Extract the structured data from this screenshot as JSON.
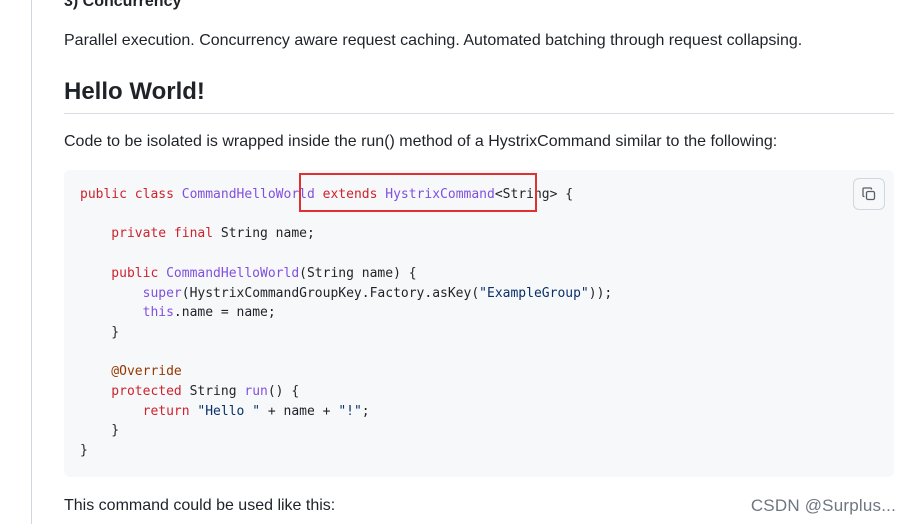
{
  "section": {
    "heading": "3) Concurrency",
    "paragraph": "Parallel execution. Concurrency aware request caching. Automated batching through request collapsing."
  },
  "hello": {
    "title": "Hello World!",
    "intro": "Code to be isolated is wrapped inside the run() method of a HystrixCommand similar to the following:",
    "outro": "This command could be used like this:"
  },
  "code": {
    "line1": {
      "kw1": "public class ",
      "cls": "CommandHelloWorld",
      "kw2": " extends ",
      "sup": "HystrixCommand",
      "rest": "<String> {"
    },
    "line3": {
      "kw": "    private final ",
      "rest": "String name;"
    },
    "line5": {
      "kw": "    public ",
      "fn": "CommandHelloWorld",
      "rest": "(String name) {"
    },
    "line6": {
      "kw": "        super",
      "rest": "(HystrixCommandGroupKey.Factory.asKey(",
      "str": "\"ExampleGroup\"",
      "end": "));"
    },
    "line7": {
      "kw": "        this",
      "rest": ".name = name;"
    },
    "line8": "    }",
    "line10": {
      "an": "    @Override"
    },
    "line11": {
      "kw": "    protected ",
      "rest1": "String ",
      "fn": "run",
      "rest2": "() {"
    },
    "line12": {
      "kw": "        return ",
      "str1": "\"Hello \"",
      "mid": " + name + ",
      "str2": "\"!\"",
      "end": ";"
    },
    "line13": "    }",
    "line14": "}"
  },
  "copy_button": {
    "icon": "copy-icon"
  },
  "annotation": {
    "color": "#e03131"
  },
  "watermark": "CSDN @Surplus..."
}
